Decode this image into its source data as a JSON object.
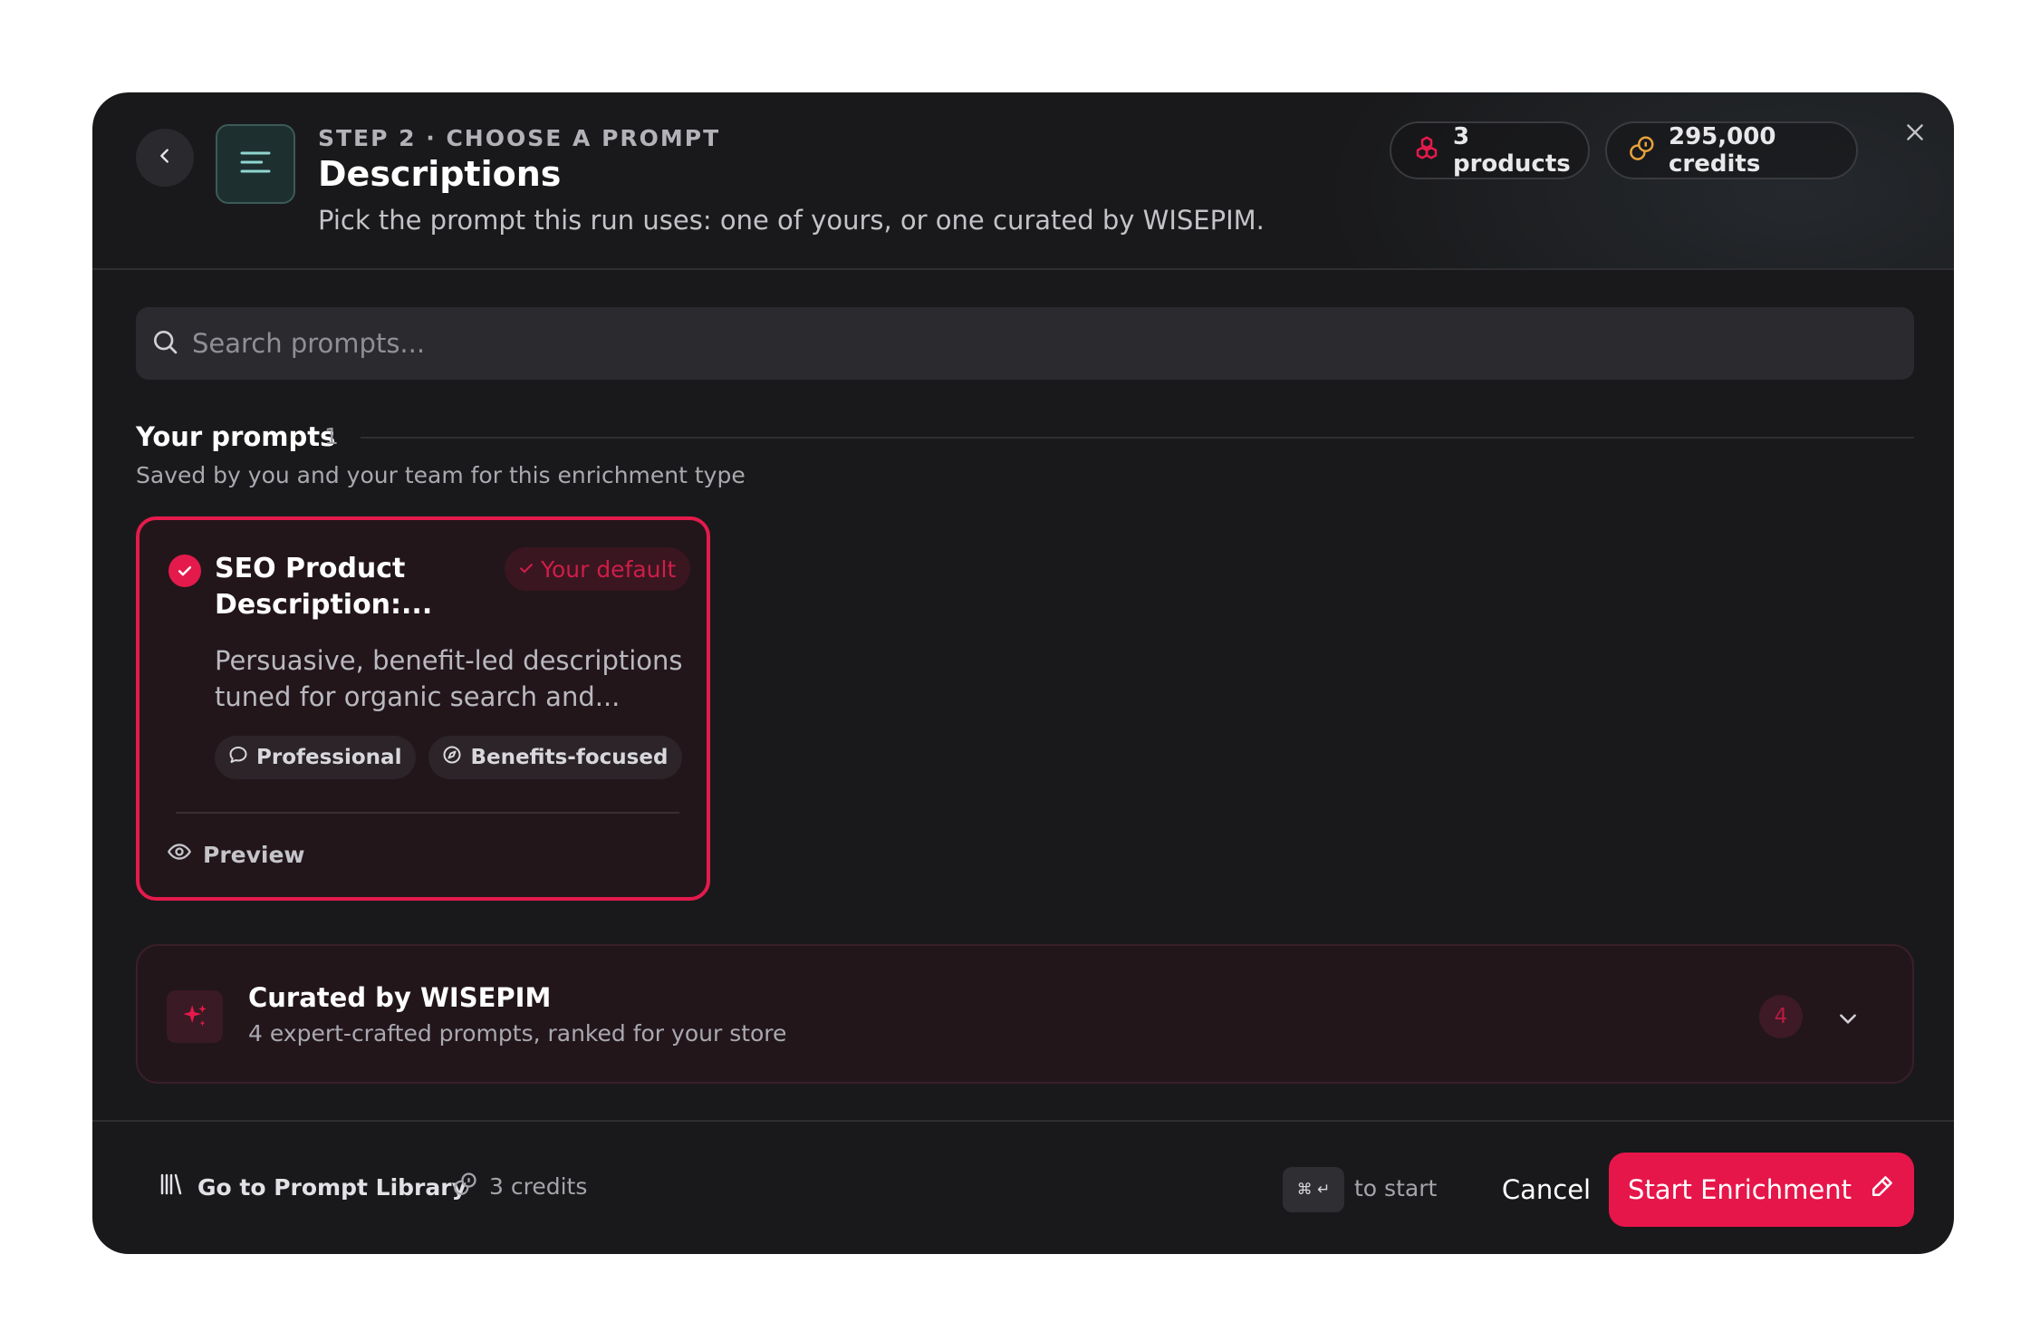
{
  "header": {
    "step_label": "STEP 2 · CHOOSE A PROMPT",
    "title": "Descriptions",
    "subtitle": "Pick the prompt this run uses: one of yours, or one curated by WISEPIM.",
    "products_pill": "3 products",
    "credits_pill": "295,000 credits",
    "icons": {
      "back": "chevron-left-icon",
      "type": "text-lines-icon",
      "products": "cubes-icon",
      "credits": "coins-icon",
      "close": "close-icon"
    }
  },
  "search": {
    "placeholder": "Search prompts...",
    "value": ""
  },
  "your_prompts": {
    "title": "Your prompts",
    "count": "1",
    "subtitle": "Saved by you and your team for this enrichment type",
    "cards": [
      {
        "title": "SEO Product Description:...",
        "badge": "Your default",
        "description": "Persuasive, benefit-led descriptions tuned for organic search and...",
        "tags": [
          "Professional",
          "Benefits-focused"
        ],
        "preview_label": "Preview",
        "selected": true
      }
    ]
  },
  "curated": {
    "title": "Curated by WISEPIM",
    "subtitle": "4 expert-crafted prompts, ranked for your store",
    "count": "4",
    "expanded": false
  },
  "footer": {
    "library_link": "Go to Prompt Library",
    "credits": "3 credits",
    "shortcut_keys": "⌘ ↵",
    "shortcut_hint": "to start",
    "cancel_label": "Cancel",
    "start_label": "Start Enrichment"
  },
  "colors": {
    "accent": "#e7164a",
    "background": "#19191b",
    "card_background": "#22161b",
    "credits_icon": "#e8a23a",
    "type_icon": "#8fd6d0"
  }
}
